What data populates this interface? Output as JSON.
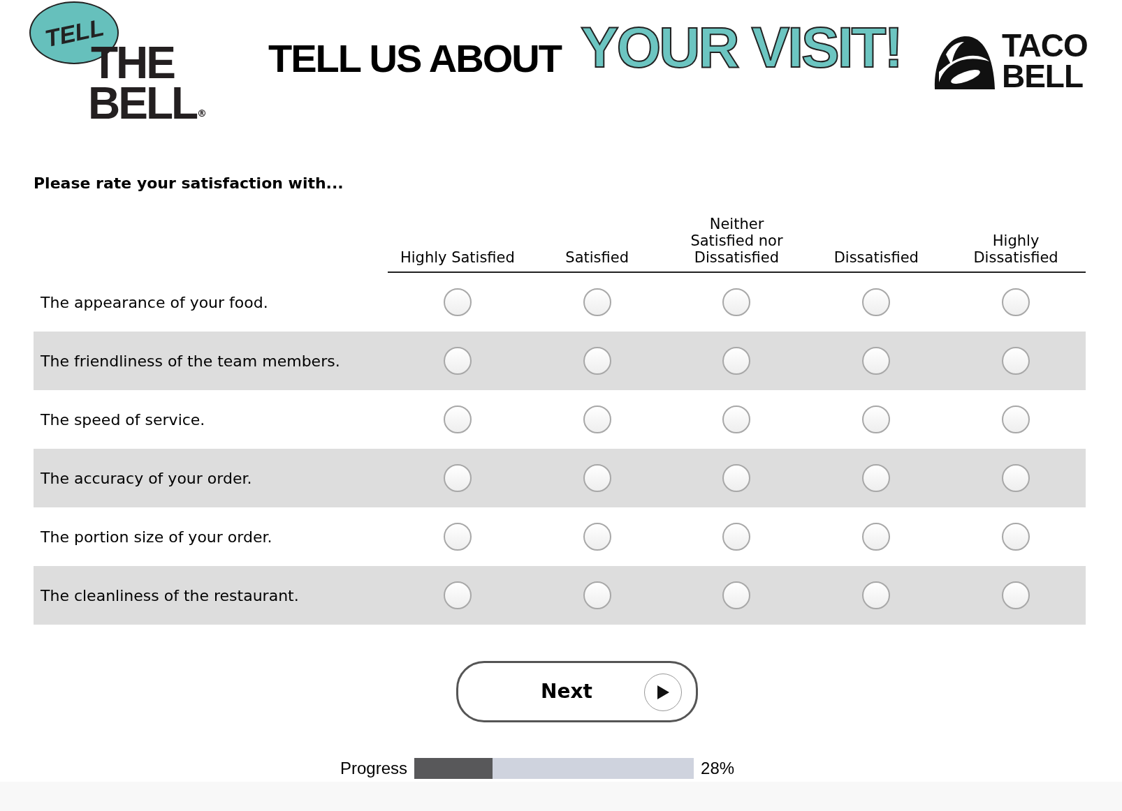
{
  "header": {
    "brand_badge": "TELL",
    "brand_text": [
      "THE",
      "BELL"
    ],
    "registered_mark": "®",
    "headline": "TELL US ABOUT",
    "headline_accent": "YOUR VISIT!",
    "partner_logo": [
      "TACO",
      "BELL"
    ]
  },
  "question": "Please rate your satisfaction with...",
  "columns": [
    [
      "Highly Satisfied"
    ],
    [
      "Satisfied"
    ],
    [
      "Neither",
      "Satisfied nor",
      "Dissatisfied"
    ],
    [
      "Dissatisfied"
    ],
    [
      "Highly",
      "Dissatisfied"
    ]
  ],
  "rows": [
    {
      "label": "The appearance of your food.",
      "choices": [
        {
          "selected": false
        },
        {
          "selected": false
        },
        {
          "selected": false
        },
        {
          "selected": false
        },
        {
          "selected": false
        }
      ]
    },
    {
      "label": "The friendliness of the team members.",
      "choices": [
        {
          "selected": false
        },
        {
          "selected": false
        },
        {
          "selected": false
        },
        {
          "selected": false
        },
        {
          "selected": false
        }
      ]
    },
    {
      "label": "The speed of service.",
      "choices": [
        {
          "selected": false
        },
        {
          "selected": false
        },
        {
          "selected": false
        },
        {
          "selected": false
        },
        {
          "selected": false
        }
      ]
    },
    {
      "label": "The accuracy of your order.",
      "choices": [
        {
          "selected": false
        },
        {
          "selected": false
        },
        {
          "selected": false
        },
        {
          "selected": false
        },
        {
          "selected": false
        }
      ]
    },
    {
      "label": "The portion size of your order.",
      "choices": [
        {
          "selected": false
        },
        {
          "selected": false
        },
        {
          "selected": false
        },
        {
          "selected": false
        },
        {
          "selected": false
        }
      ]
    },
    {
      "label": "The cleanliness of the restaurant.",
      "choices": [
        {
          "selected": false
        },
        {
          "selected": false
        },
        {
          "selected": false
        },
        {
          "selected": false
        },
        {
          "selected": false
        }
      ]
    }
  ],
  "next_button": "Next",
  "progress": {
    "label": "Progress",
    "level": 0.28,
    "reading": "28%"
  }
}
